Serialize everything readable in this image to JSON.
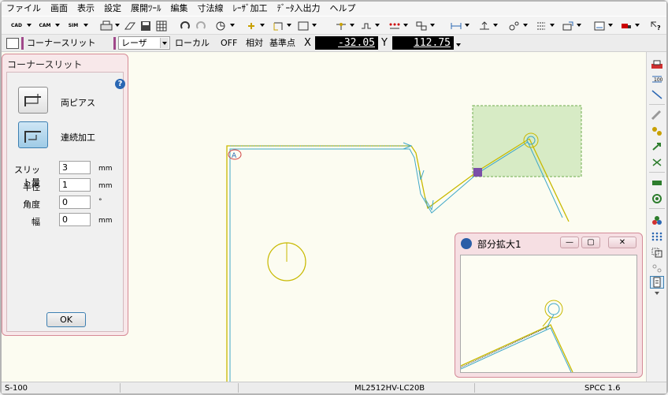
{
  "menu": [
    "ファイル",
    "画面",
    "表示",
    "設定",
    "展開ﾂｰﾙ",
    "編集",
    "寸法線",
    "ﾚｰｻﾞ加工",
    "ﾃﾞｰﾀ入出力",
    "ヘルプ"
  ],
  "toolbar": {
    "cad": "CAD",
    "cam": "CAM",
    "sim": "SIM"
  },
  "modebar": {
    "mode_label": "コーナースリット",
    "laser_combo": "レーザ",
    "local": "ローカル",
    "off": "OFF",
    "relative": "相対",
    "base_point": "基準点",
    "x_label": "X",
    "x_value": "-32.05",
    "y_label": "Y",
    "y_value": "112.75"
  },
  "dialog": {
    "title": "コーナースリット",
    "help": "?",
    "option1": "両ピアス",
    "option2": "連続加工",
    "fields": [
      {
        "label": "スリット量",
        "value": "3",
        "unit": "mm"
      },
      {
        "label": "半径",
        "value": "1",
        "unit": "mm"
      },
      {
        "label": "角度",
        "value": "0",
        "unit": "°"
      },
      {
        "label": "幅",
        "value": "0",
        "unit": "mm"
      }
    ],
    "ok": "OK"
  },
  "zoom_window": {
    "title": "部分拡大1",
    "min": "—",
    "max": "▢",
    "close": "✕"
  },
  "canvas": {
    "marker_label": "A"
  },
  "statusbar": {
    "left": "S-100",
    "middle": "ML2512HV-LC20B",
    "right": "SPCC 1.6"
  },
  "colors": {
    "canvas_bg": "#fcfcf1",
    "part_line": "#c8b900",
    "path_line": "#3fa7c8",
    "selection_fill": "#b8dca0",
    "dialog_border": "#d68a96"
  }
}
